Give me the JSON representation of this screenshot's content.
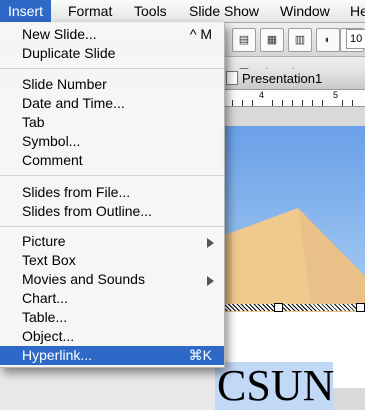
{
  "menubar": {
    "items": [
      {
        "label": "Insert",
        "active": true
      },
      {
        "label": "Format"
      },
      {
        "label": "Tools"
      },
      {
        "label": "Slide Show"
      },
      {
        "label": "Window"
      },
      {
        "label": "He"
      }
    ]
  },
  "insert_menu": {
    "new_slide": "New Slide...",
    "new_slide_shortcut": "^ M",
    "duplicate_slide": "Duplicate Slide",
    "slide_number": "Slide Number",
    "date_time": "Date and Time...",
    "tab": "Tab",
    "symbol": "Symbol...",
    "comment": "Comment",
    "slides_from_file": "Slides from File...",
    "slides_from_outline": "Slides from Outline...",
    "picture": "Picture",
    "text_box": "Text Box",
    "movies_sounds": "Movies and Sounds",
    "chart": "Chart...",
    "table": "Table...",
    "object": "Object...",
    "hyperlink": "Hyperlink...",
    "hyperlink_shortcut": "⌘K"
  },
  "window": {
    "title": "Presentation1",
    "zoom": "10"
  },
  "ruler": {
    "marks": [
      "4",
      "5"
    ]
  },
  "slide": {
    "text": "CSUN"
  },
  "colors": {
    "menu_highlight": "#2f69c8",
    "selection": "#c2d8f7"
  }
}
